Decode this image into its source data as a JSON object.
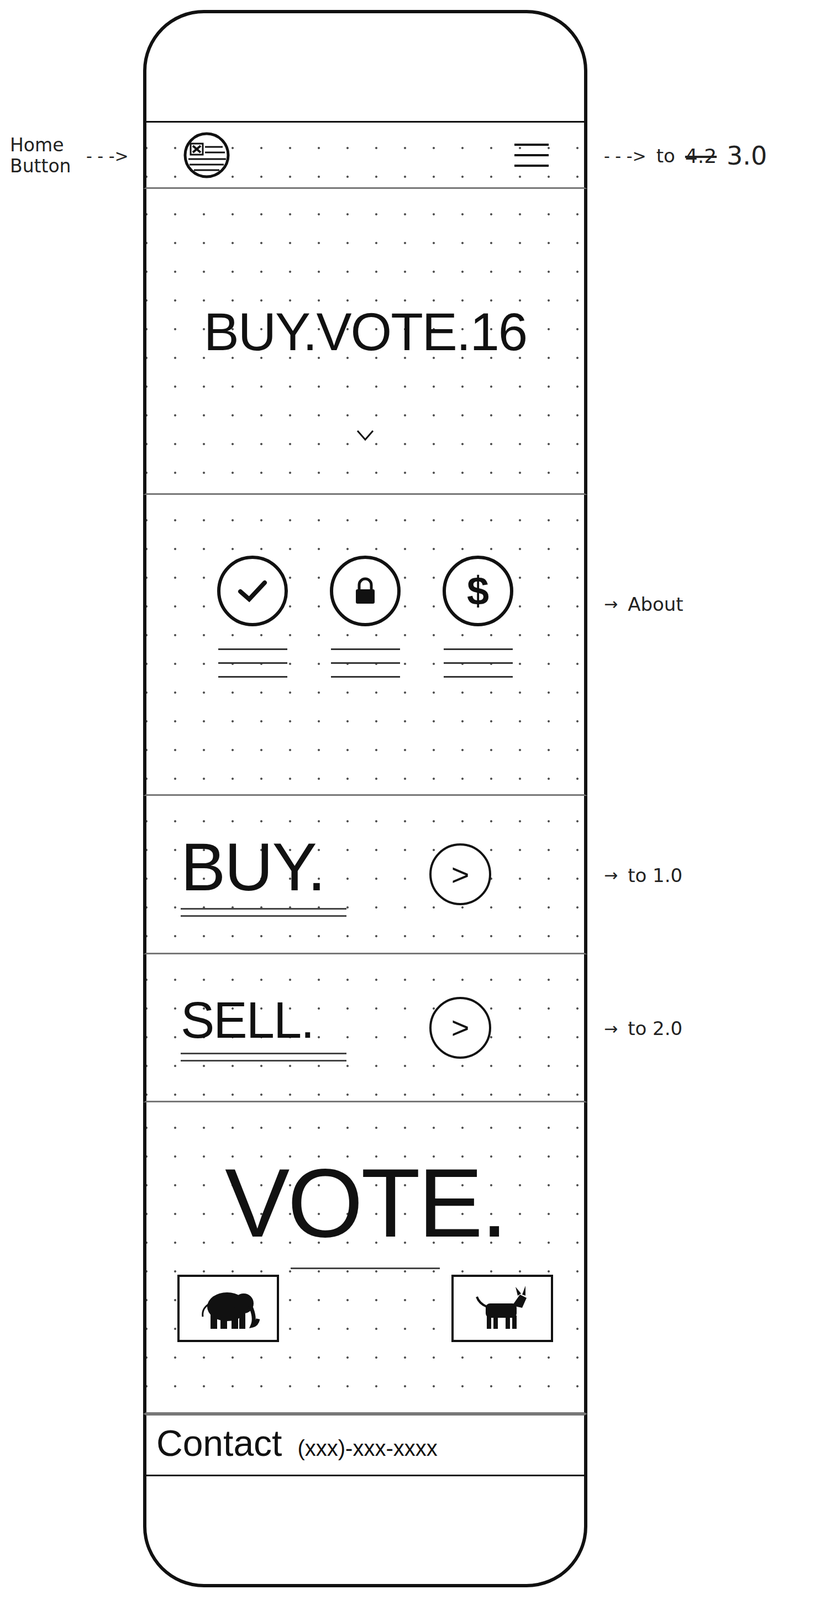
{
  "annotations": {
    "home": {
      "label": "Home Button",
      "arrow": "- - ->"
    },
    "menu": {
      "arrow": "- - ->",
      "prefix": "to",
      "struck": "4.2",
      "target": "3.0"
    },
    "about": {
      "arrow": "→",
      "label": "About"
    },
    "buy": {
      "arrow": "→",
      "label": "to 1.0"
    },
    "sell": {
      "arrow": "→",
      "label": "to 2.0"
    }
  },
  "hero": {
    "title": "BUY.VOTE.16"
  },
  "features": [
    {
      "kind": "check"
    },
    {
      "kind": "lock"
    },
    {
      "kind": "dollar",
      "symbol": "$"
    }
  ],
  "buy": {
    "title": "BUY.",
    "arrow": ">"
  },
  "sell": {
    "title": "SELL.",
    "arrow": ">"
  },
  "vote": {
    "title": "VOTE.",
    "parties": [
      {
        "kind": "elephant"
      },
      {
        "kind": "donkey"
      }
    ]
  },
  "contact": {
    "label": "Contact",
    "phone": "(xxx)-xxx-xxxx"
  }
}
